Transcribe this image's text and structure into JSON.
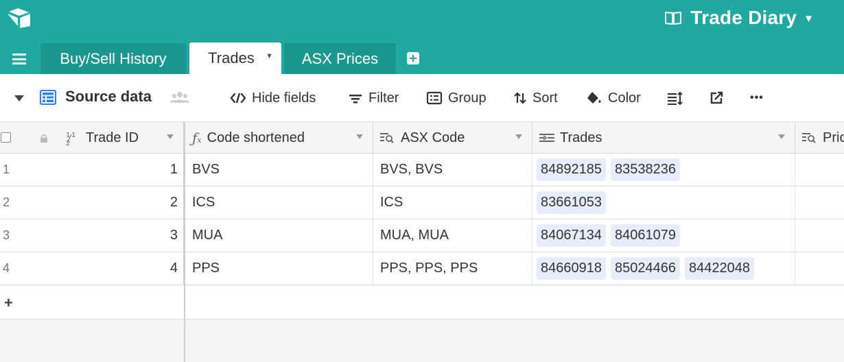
{
  "app": {
    "base_name": "Trade Diary",
    "accent_color": "#1fa9a1"
  },
  "tabs": [
    {
      "label": "Buy/Sell History",
      "active": false
    },
    {
      "label": "Trades",
      "active": true
    },
    {
      "label": "ASX Prices",
      "active": false
    }
  ],
  "toolbar": {
    "view_name": "Source data",
    "hide_fields": "Hide fields",
    "filter": "Filter",
    "group": "Group",
    "sort": "Sort",
    "color": "Color",
    "more": "•••"
  },
  "columns": [
    {
      "label": "Trade ID",
      "icon": "number-icon"
    },
    {
      "label": "Code shortened",
      "icon": "formula-icon"
    },
    {
      "label": "ASX Code",
      "icon": "lookup-icon"
    },
    {
      "label": "Trades",
      "icon": "link-icon"
    },
    {
      "label": "Pric",
      "icon": "lookup-icon"
    }
  ],
  "rows": [
    {
      "num": "1",
      "trade_id": "1",
      "code_short": "BVS",
      "asx_code": "BVS, BVS",
      "trades": [
        "84892185",
        "83538236"
      ]
    },
    {
      "num": "2",
      "trade_id": "2",
      "code_short": "ICS",
      "asx_code": "ICS",
      "trades": [
        "83661053"
      ]
    },
    {
      "num": "3",
      "trade_id": "3",
      "code_short": "MUA",
      "asx_code": "MUA, MUA",
      "trades": [
        "84067134",
        "84061079"
      ]
    },
    {
      "num": "4",
      "trade_id": "4",
      "code_short": "PPS",
      "asx_code": "PPS, PPS, PPS",
      "trades": [
        "84660918",
        "85024466",
        "84422048"
      ]
    }
  ],
  "add_row": "+"
}
